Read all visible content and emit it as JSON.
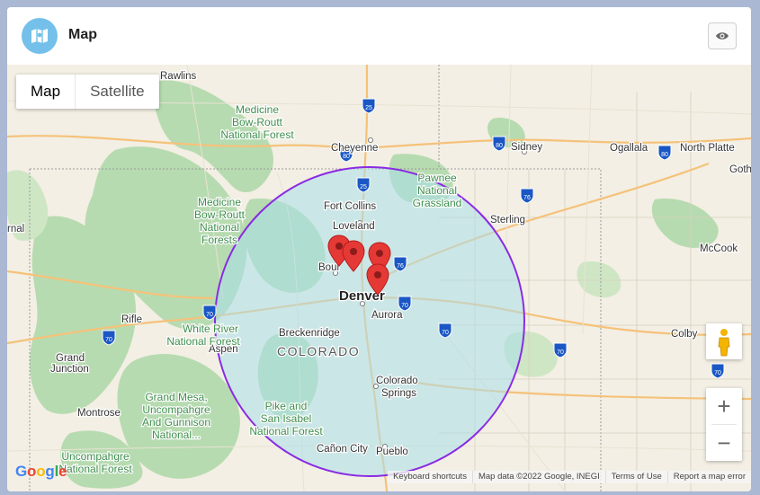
{
  "header": {
    "title": "Map",
    "icon": "map-icon",
    "visibility_icon": "eye-icon"
  },
  "map_type": {
    "options": [
      "Map",
      "Satellite"
    ],
    "selected": "Map"
  },
  "places": {
    "rawlins": "Rawlins",
    "medicine_bow_1": "Medicine",
    "medicine_bow_2": "Bow-Routt",
    "medicine_bow_3": "National Forest",
    "cheyenne": "Cheyenne",
    "sidney": "Sidney",
    "ogallala": "Ogallala",
    "north_platte": "North Platte",
    "gothenburg": "Goth",
    "pawnee_1": "Pawnee",
    "pawnee_2": "National",
    "pawnee_3": "Grassland",
    "fort_collins": "Fort Collins",
    "loveland": "Loveland",
    "sterling": "Sterling",
    "mccook": "McCook",
    "mb2_1": "Medicine",
    "mb2_2": "Bow-Routt",
    "mb2_3": "National",
    "mb2_4": "Forests",
    "rnal": "rnal",
    "boulder": "Boul",
    "denver": "Denver",
    "aurora": "Aurora",
    "rifle": "Rifle",
    "white_river_1": "White River",
    "white_river_2": "National Forest",
    "aspen": "Aspen",
    "breckenridge": "Breckenridge",
    "colorado": "COLORADO",
    "colby": "Colby",
    "grand_junction_1": "Grand",
    "grand_junction_2": "Junction",
    "grand_mesa_1": "Grand Mesa,",
    "grand_mesa_2": "Uncompahgre",
    "grand_mesa_3": "And Gunnison",
    "grand_mesa_4": "National...",
    "colorado_springs_1": "Colorado",
    "colorado_springs_2": "Springs",
    "pike_1": "Pike and",
    "pike_2": "San Isabel",
    "pike_3": "National Forest",
    "montrose": "Montrose",
    "uncompahgre_1": "Uncompahgre",
    "uncompahgre_2": "National Forest",
    "canon_city": "Cañon City",
    "pueblo": "Pueblo"
  },
  "shields": {
    "i25_north": "25",
    "i80_cheyenne": "80",
    "i80_sidney": "80",
    "i80_ogallala": "80",
    "i25_ftcollins": "25",
    "i76_north": "76",
    "i76_denver": "76",
    "i70_denver": "70",
    "i70_east": "70",
    "i70_west": "70",
    "i70_rifle": "70",
    "i70_colby": "70",
    "i70_far_east": "70"
  },
  "controls": {
    "zoom_in": "+",
    "zoom_out": "−"
  },
  "footer": {
    "logo": "Google",
    "keyboard": "Keyboard shortcuts",
    "map_data": "Map data ©2022 Google, INEGI",
    "terms": "Terms of Use",
    "report": "Report a map error"
  },
  "colors": {
    "radius_stroke": "#8a2be2",
    "radius_fill": "#a9dfea",
    "marker": "#e53935",
    "forest": "#a8d5a3",
    "header_icon_bg": "#74c0ea"
  }
}
